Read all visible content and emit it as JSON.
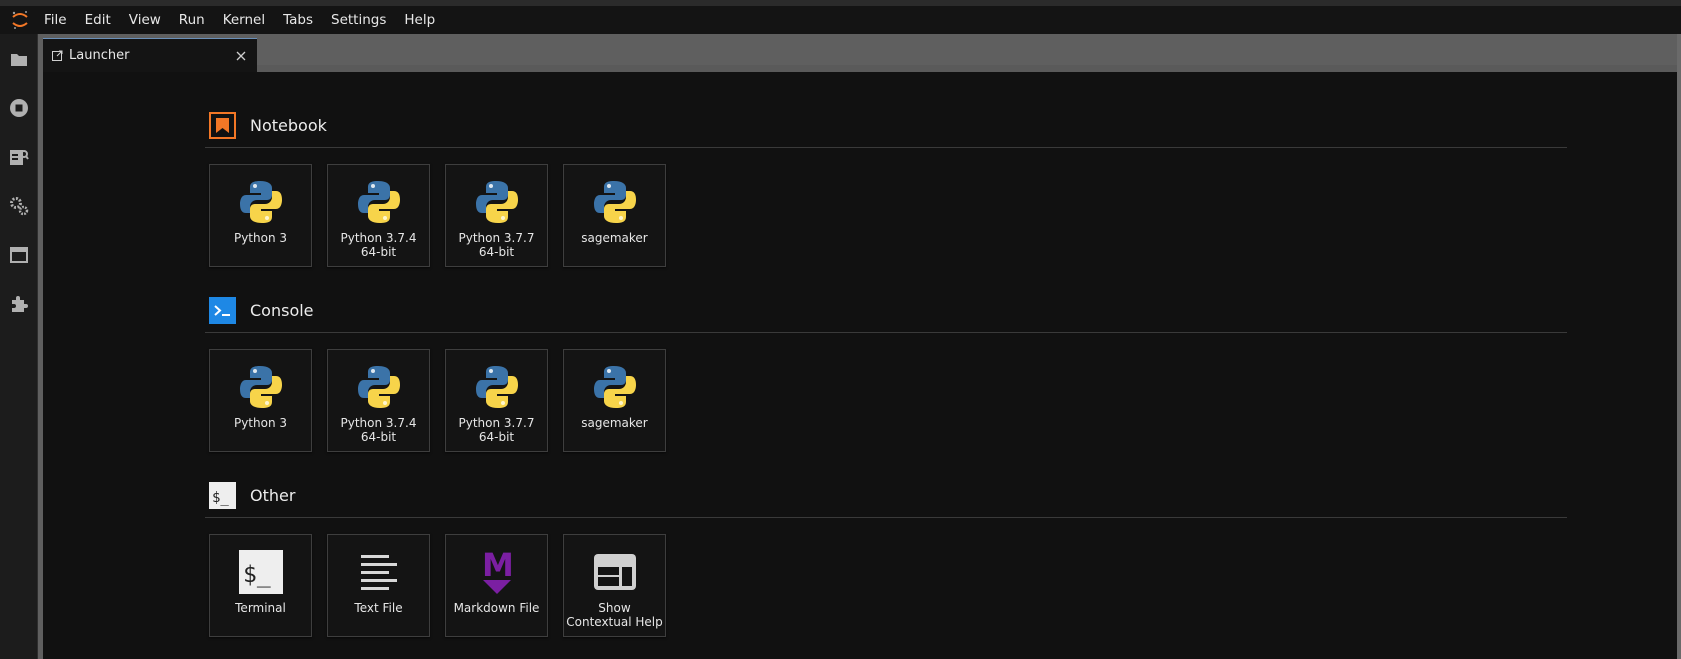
{
  "menubar": {
    "items": [
      "File",
      "Edit",
      "View",
      "Run",
      "Kernel",
      "Tabs",
      "Settings",
      "Help"
    ]
  },
  "sidebar": {
    "icons": [
      "folder-icon",
      "running-icon",
      "property-inspector-icon",
      "gears-icon",
      "tabs-icon",
      "extension-icon"
    ]
  },
  "tab": {
    "label": "Launcher"
  },
  "sections": {
    "notebook": {
      "title": "Notebook",
      "cards": [
        "Python 3",
        "Python 3.7.4\n64-bit",
        "Python 3.7.7\n64-bit",
        "sagemaker"
      ]
    },
    "console": {
      "title": "Console",
      "cards": [
        "Python 3",
        "Python 3.7.4\n64-bit",
        "Python 3.7.7\n64-bit",
        "sagemaker"
      ]
    },
    "other": {
      "title": "Other",
      "icon_text": "$_",
      "cards": [
        "Terminal",
        "Text File",
        "Markdown File",
        "Show\nContextual Help"
      ],
      "terminal_icon_text": "$_",
      "markdown_icon_text": "M"
    }
  },
  "colors": {
    "accent_orange": "#f37726",
    "console_blue": "#1e88e5",
    "markdown_purple": "#7b1fa2"
  }
}
